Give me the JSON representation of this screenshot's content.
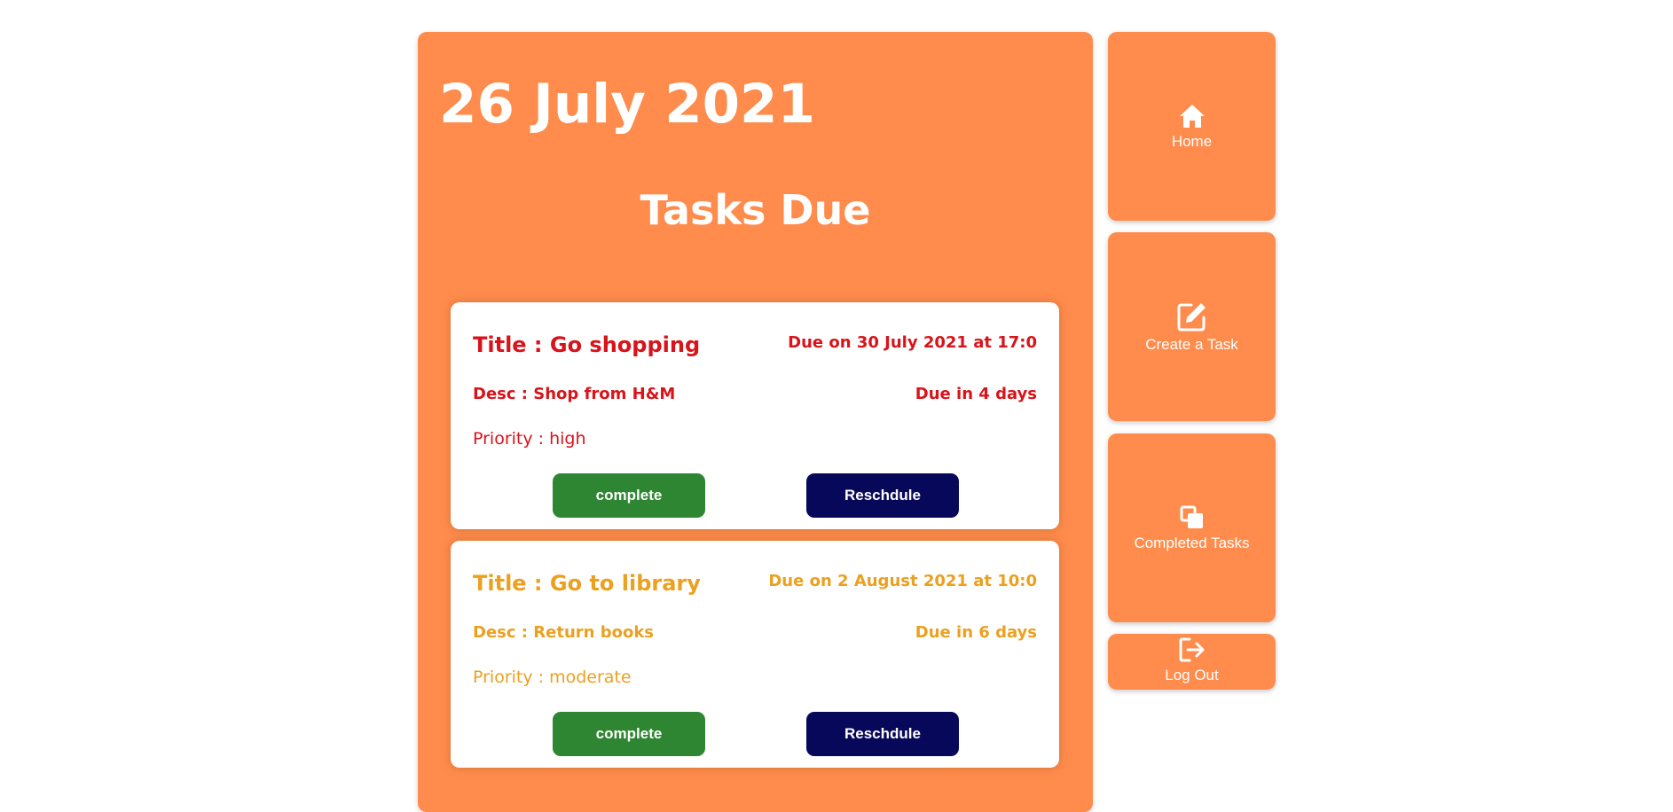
{
  "page": {
    "date": "26 July 2021",
    "heading": "Tasks Due"
  },
  "tasks": [
    {
      "title": "Title : Go shopping",
      "due_on": "Due on 30 July 2021 at 17:0",
      "desc": "Desc : Shop from H&M",
      "due_in": "Due in 4 days",
      "priority": "Priority : high",
      "color": "#d9131a",
      "complete_label": "complete",
      "reschedule_label": "Reschdule"
    },
    {
      "title": "Title : Go to library",
      "due_on": "Due on 2 August 2021 at 10:0",
      "desc": "Desc : Return books",
      "due_in": "Due in 6 days",
      "priority": "Priority : moderate",
      "color": "#eba020",
      "complete_label": "complete",
      "reschedule_label": "Reschdule"
    }
  ],
  "nav": {
    "home": {
      "label": "Home",
      "icon": "home-icon"
    },
    "create": {
      "label": "Create a Task",
      "icon": "edit-icon"
    },
    "completed": {
      "label": "Completed Tasks",
      "icon": "copy-icon"
    },
    "logout": {
      "label": "Log Out",
      "icon": "logout-icon"
    }
  },
  "colors": {
    "panel": "#ff8c4c",
    "complete_button": "#2e8532",
    "reschedule_button": "#08085a",
    "priority_high": "#d9131a",
    "priority_moderate": "#eba020"
  }
}
